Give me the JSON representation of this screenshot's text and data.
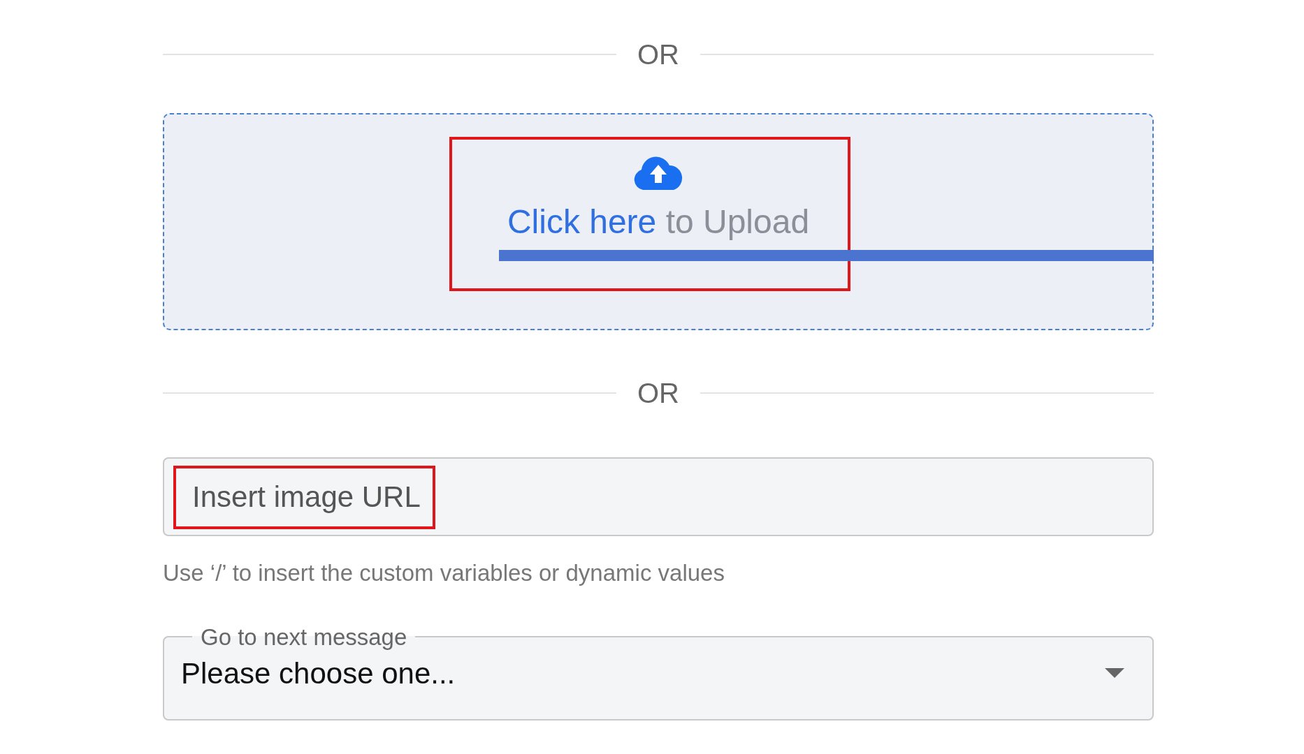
{
  "divider_top": {
    "text": "OR"
  },
  "upload": {
    "link_text": "Click here",
    "text": "to Upload",
    "highlighted": true,
    "struck": true
  },
  "divider_middle": {
    "text": "OR"
  },
  "url_field": {
    "placeholder": "Insert image URL",
    "highlighted": true,
    "hint": "Use ‘/’ to insert the custom variables or dynamic values"
  },
  "next_message": {
    "label": "Go to next message",
    "value": "Please choose one..."
  }
}
